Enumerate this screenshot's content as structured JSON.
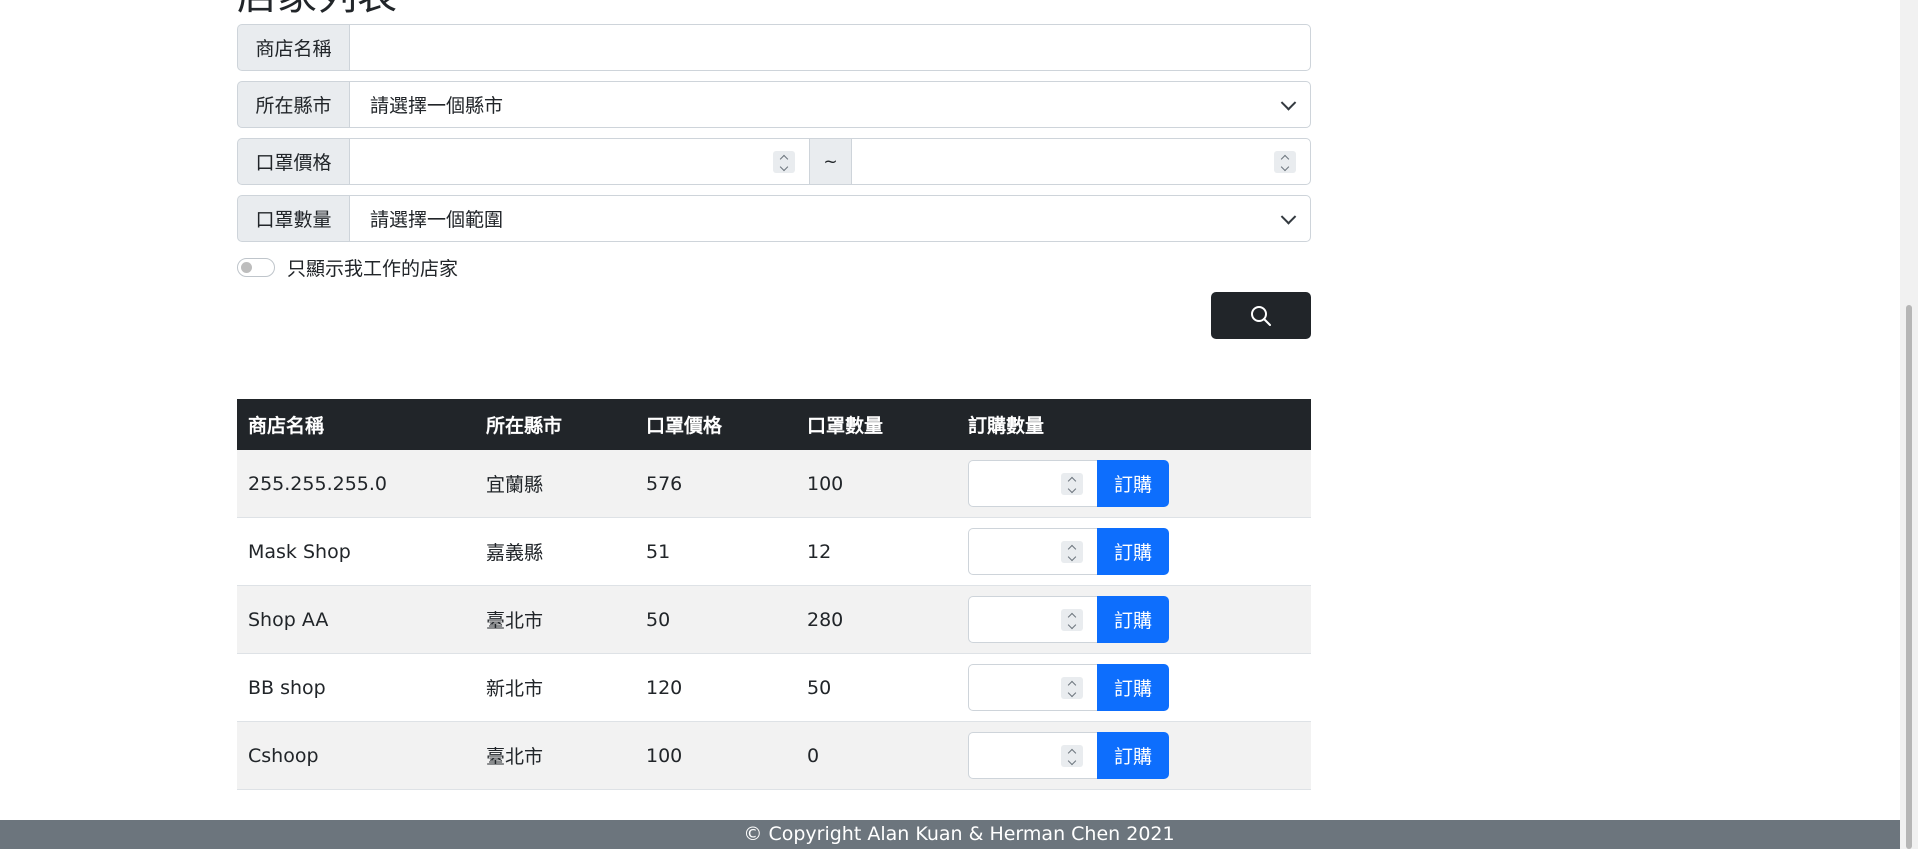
{
  "page": {
    "title": "店家列表"
  },
  "filters": {
    "shop_name": {
      "label": "商店名稱",
      "value": ""
    },
    "city": {
      "label": "所在縣市",
      "selected": "請選擇一個縣市"
    },
    "price": {
      "label": "口罩價格",
      "min": "",
      "max": "",
      "separator": "~"
    },
    "quantity": {
      "label": "口罩數量",
      "selected": "請選擇一個範圍"
    },
    "my_shops_toggle": {
      "label": "只顯示我工作的店家",
      "checked": false
    }
  },
  "search_button": {
    "icon": "search-icon"
  },
  "table": {
    "headers": [
      "商店名稱",
      "所在縣市",
      "口罩價格",
      "口罩數量",
      "訂購數量"
    ],
    "order_label": "訂購",
    "rows": [
      {
        "name": "255.255.255.0",
        "city": "宜蘭縣",
        "price": "576",
        "quantity": "100"
      },
      {
        "name": "Mask Shop",
        "city": "嘉義縣",
        "price": "51",
        "quantity": "12"
      },
      {
        "name": "Shop AA",
        "city": "臺北市",
        "price": "50",
        "quantity": "280"
      },
      {
        "name": "BB shop",
        "city": "新北市",
        "price": "120",
        "quantity": "50"
      },
      {
        "name": "Cshoop",
        "city": "臺北市",
        "price": "100",
        "quantity": "0"
      }
    ]
  },
  "footer": {
    "text": "© Copyright Alan Kuan & Herman Chen 2021"
  },
  "colors": {
    "header_bg": "#212529",
    "order_btn": "#0d6efd",
    "footer_bg": "#6c757d"
  }
}
